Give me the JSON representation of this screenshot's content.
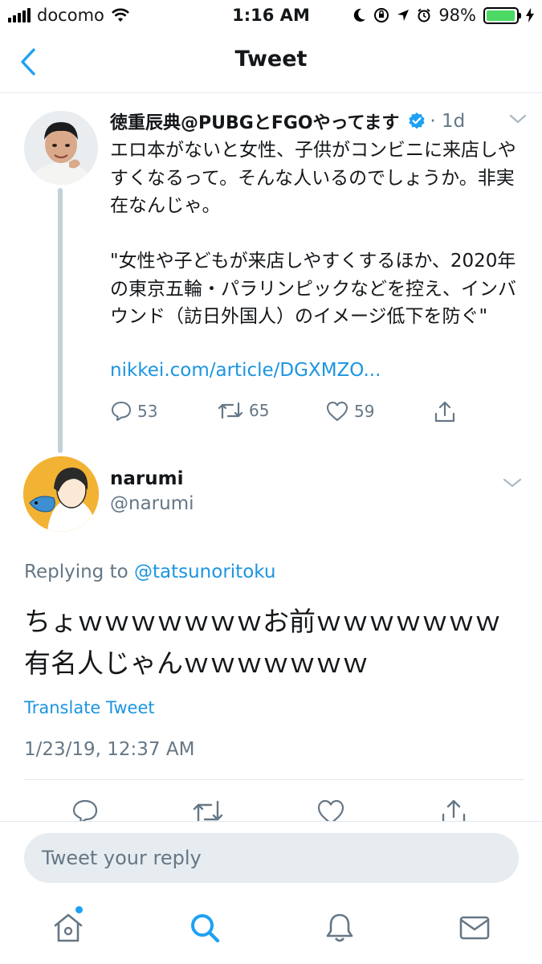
{
  "status_bar": {
    "carrier": "docomo",
    "time": "1:16 AM",
    "battery": "98%",
    "battery_level": 0.98
  },
  "nav": {
    "title": "Tweet",
    "back_icon": "chevron-left-icon"
  },
  "parent_tweet": {
    "name": "徳重辰典@PUBGとFGOやってます",
    "time": "· 1d",
    "body": "エロ本がないと女性、子供がコンビニに来店しやすくなるって。そんな人いるのでしょうか。非実在なんじゃ。\n\n\"女性や子どもが来店しやすくするほか、2020年の東京五輪・パラリンピックなどを控え、インバウンド（訪日外国人）のイメージ低下を防ぐ\"",
    "link": "nikkei.com/article/DGXMZO...",
    "replies": "53",
    "retweets": "65",
    "likes": "59"
  },
  "reply_tweet": {
    "name": "narumi",
    "handle": "@narumi",
    "replying_prefix": "Replying to ",
    "replying_to": "@tatsunoritoku",
    "text": "ちょｗｗｗｗｗｗｗお前ｗｗｗｗｗｗｗ有名人じゃんｗｗｗｗｗｗｗ",
    "translate": "Translate Tweet",
    "timestamp": "1/23/19, 12:37 AM"
  },
  "reply_box": {
    "placeholder": "Tweet your reply"
  },
  "tabs": [
    "home-icon",
    "search-icon",
    "notifications-icon",
    "messages-icon"
  ],
  "colors": {
    "accent": "#1da1f2",
    "link": "#1b95e0",
    "muted": "#657786",
    "battery": "#4cd964"
  }
}
